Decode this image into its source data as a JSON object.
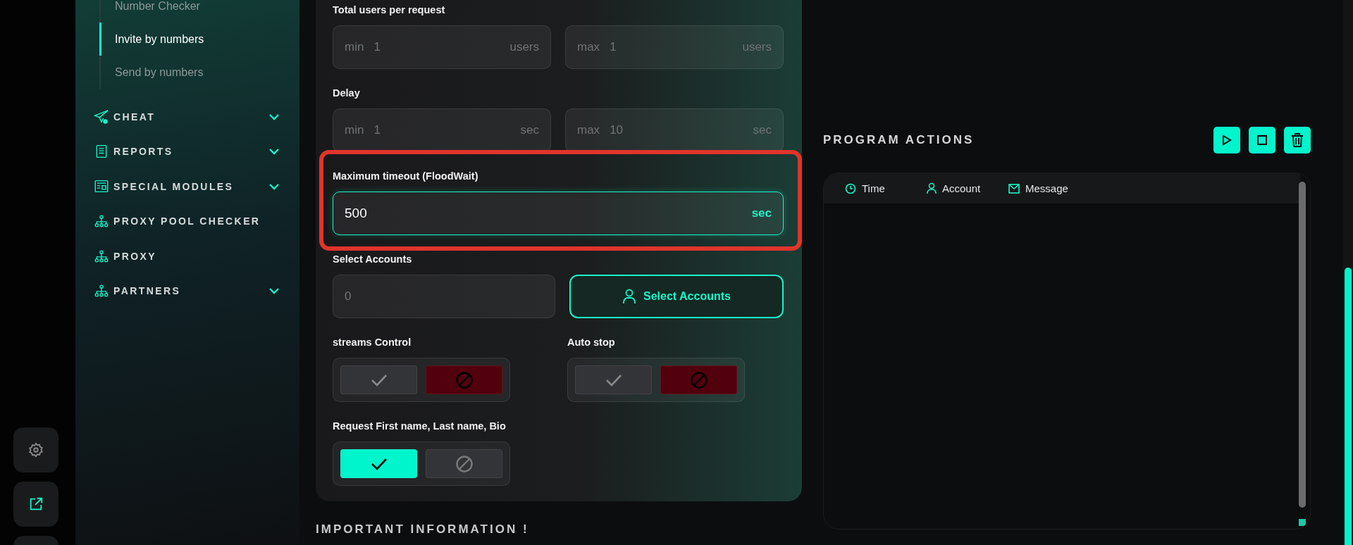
{
  "sidebar": {
    "submenu": [
      {
        "label": "Number Checker",
        "selected": false
      },
      {
        "label": "Invite by numbers",
        "selected": true
      },
      {
        "label": "Send by numbers",
        "selected": false
      }
    ],
    "items": [
      {
        "label": "CHEAT",
        "kind": "plane",
        "expandable": true
      },
      {
        "label": "REPORTS",
        "kind": "receipt",
        "expandable": true
      },
      {
        "label": "SPECIAL MODULES",
        "kind": "news",
        "expandable": true
      },
      {
        "label": "PROXY POOL CHECKER",
        "kind": "tree",
        "expandable": false
      },
      {
        "label": "PROXY",
        "kind": "tree",
        "expandable": false
      },
      {
        "label": "PARTNERS",
        "kind": "tree",
        "expandable": true
      }
    ]
  },
  "form": {
    "users_per_request": {
      "label": "Total users per request",
      "min": {
        "prefix": "min",
        "placeholder": "1",
        "unit": "users"
      },
      "max": {
        "prefix": "max",
        "placeholder": "1",
        "unit": "users"
      }
    },
    "delay": {
      "label": "Delay",
      "min": {
        "prefix": "min",
        "placeholder": "1",
        "unit": "sec"
      },
      "max": {
        "prefix": "max",
        "placeholder": "10",
        "unit": "sec"
      }
    },
    "timeout": {
      "label": "Maximum timeout (FloodWait)",
      "value": "500",
      "unit": "sec",
      "highlighted": true
    },
    "accounts": {
      "label": "Select Accounts",
      "count": "0",
      "button": "Select Accounts"
    },
    "toggles": [
      {
        "label": "streams Control",
        "enabled": false
      },
      {
        "label": "Auto stop",
        "enabled": false
      },
      {
        "label": "Request First name, Last name, Bio",
        "enabled": true
      }
    ]
  },
  "important_heading": "IMPORTANT INFORMATION !",
  "program_actions": {
    "title": "PROGRAM ACTIONS",
    "columns": [
      {
        "label": "Time",
        "kind": "clock"
      },
      {
        "label": "Account",
        "kind": "user"
      },
      {
        "label": "Message",
        "kind": "mail"
      }
    ]
  }
}
